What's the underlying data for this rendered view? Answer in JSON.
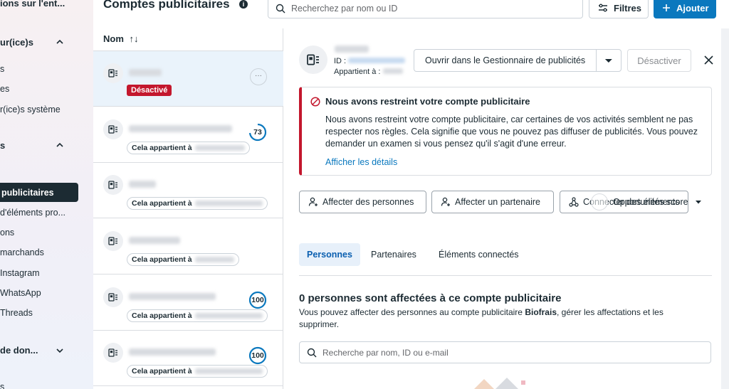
{
  "sidebar": {
    "items": [
      {
        "label": "ions sur l'ent...",
        "bold": true
      },
      {
        "label": "ur(ice)s",
        "bold": true
      },
      {
        "label": "s"
      },
      {
        "label": "es"
      },
      {
        "label": "r(ice)s système"
      },
      {
        "label": "s",
        "bold": true
      },
      {
        "label": "publicitaires",
        "active": true
      },
      {
        "label": "d'éléments pro..."
      },
      {
        "label": "ons"
      },
      {
        "label": "marchands"
      },
      {
        "label": "Instagram"
      },
      {
        "label": "WhatsApp"
      },
      {
        "label": "Threads"
      },
      {
        "label": "de don...",
        "bold": true
      },
      {
        "label": "s"
      }
    ]
  },
  "header": {
    "title": "Comptes publicitaires",
    "info_icon": "i",
    "search_placeholder": "Recherchez par nom ou ID",
    "filters_label": "Filtres",
    "add_label": "Ajouter"
  },
  "list": {
    "column_header": "Nom",
    "sort_icon": "↑↓",
    "rows": [
      {
        "status": "Désactivé",
        "selected": true,
        "more": "···"
      },
      {
        "owner_label": "Cela appartient à",
        "score": "73",
        "progress_pct": 73
      },
      {
        "owner_label": "Cela appartient à"
      },
      {
        "owner_label": "Cela appartient à"
      },
      {
        "owner_label": "Cela appartient à",
        "score": "100",
        "progress_pct": 100
      },
      {
        "owner_label": "Cela appartient à",
        "score": "100",
        "progress_pct": 100
      }
    ]
  },
  "detail": {
    "id_label": "ID :",
    "owner_label": "Appartient à :",
    "open_manager_label": "Ouvrir dans le Gestionnaire de publicités",
    "deactivate_label": "Désactiver",
    "alert": {
      "title": "Nous avons restreint votre compte publicitaire",
      "body": "Nous avons restreint votre compte publicitaire, car certaines de vos activités semblent ne pas respecter nos règles. Cela signifie que vous ne pouvez pas diffuser de publicités. Vous pouvez demander un examen si vous pensez qu'il s'agit d'une erreur.",
      "link": "Afficher les détails"
    },
    "actions": {
      "assign_people": "Affecter des personnes",
      "assign_partner": "Affecter un partenaire",
      "connect_assets": "Connecter des éléments",
      "overlay_text": "Opportunités score"
    },
    "tabs": [
      "Personnes",
      "Partenaires",
      "Éléments connectés"
    ],
    "people": {
      "title": "0 personnes sont affectées à ce compte publicitaire",
      "desc_prefix": "Vous pouvez affecter des personnes au compte publicitaire ",
      "desc_account": "Biofrais",
      "desc_suffix": ", gérer les affectations et les supprimer.",
      "search_placeholder": "Recherche par nom, ID ou e-mail"
    }
  },
  "colors": {
    "primary": "#0a78be",
    "danger": "#c3172d",
    "dark": "#1c2b33",
    "selected_row": "#eaf3fb"
  }
}
